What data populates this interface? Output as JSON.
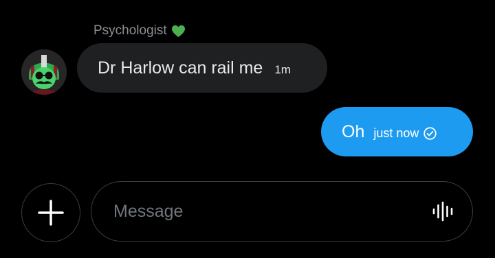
{
  "conversation": {
    "sender_name": "Psychologist",
    "sender_badge_icon": "green-heart-icon"
  },
  "messages": [
    {
      "direction": "incoming",
      "text": "Dr Harlow can rail me",
      "time": "1m"
    },
    {
      "direction": "outgoing",
      "text": "Oh",
      "time": "just now",
      "status_icon": "check-circle-icon"
    }
  ],
  "composer": {
    "add_icon": "plus-icon",
    "placeholder": "Message",
    "value": "",
    "voice_icon": "voice-waveform-icon"
  },
  "colors": {
    "background": "#000000",
    "incoming_bubble": "#1f2022",
    "outgoing_bubble": "#1d9bf0",
    "sender_label": "#8b8f94",
    "heart": "#4caf50",
    "border": "#3a3d41"
  }
}
